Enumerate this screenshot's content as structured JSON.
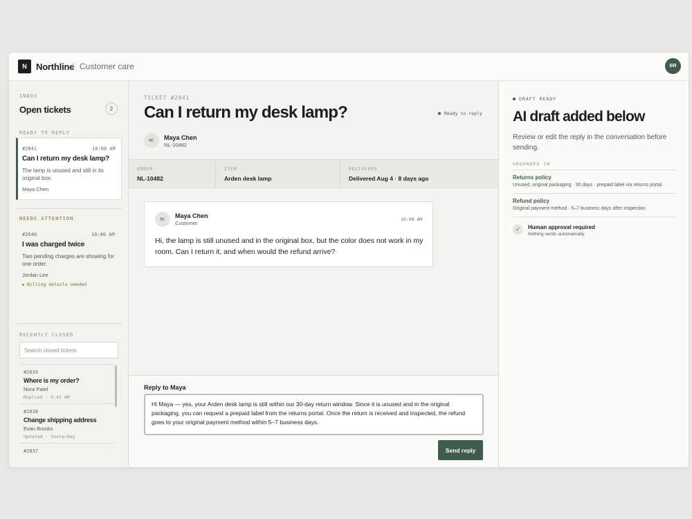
{
  "header": {
    "logo_letter": "N",
    "brand": "Northline",
    "separator": "/",
    "section": "Customer care",
    "user_initials": "BR"
  },
  "sidebar": {
    "inbox_label": "INBOX",
    "title": "Open tickets",
    "count": "2",
    "ready_label": "READY TO REPLY",
    "active_ticket": {
      "id": "#2841",
      "time": "10:08 AM",
      "title": "Can I return my desk lamp?",
      "preview": "The lamp is unused and still in its original box.",
      "customer": "Maya Chen"
    },
    "attention_label": "NEEDS ATTENTION",
    "attention_ticket": {
      "id": "#2840",
      "time": "10:06 AM",
      "title": "I was charged twice",
      "preview": "Two pending charges are showing for one order.",
      "customer": "Jordan Lee",
      "flag": "Billing details needed"
    },
    "closed_label": "RECENTLY CLOSED",
    "search_placeholder": "Search closed tickets",
    "closed": [
      {
        "id": "#2839",
        "title": "Where is my order?",
        "customer": "Nora Patel",
        "meta": "Replied · 9:42 AM"
      },
      {
        "id": "#2838",
        "title": "Change shipping address",
        "customer": "Evan Brooks",
        "meta": "Updated · Yesterday"
      },
      {
        "id": "#2837"
      }
    ]
  },
  "ticket": {
    "label": "TICKET #2841",
    "title": "Can I return my desk lamp?",
    "status": "Ready to reply",
    "customer_initials": "MC",
    "customer_name": "Maya Chen",
    "customer_id": "NL-10482",
    "meta": [
      {
        "key": "ORDER",
        "value": "NL-10482"
      },
      {
        "key": "ITEM",
        "value": "Arden desk lamp"
      },
      {
        "key": "DELIVERED",
        "value": "Delivered Aug 4 · 8 days ago"
      }
    ],
    "message": {
      "initials": "MC",
      "author": "Maya Chen",
      "role": "Customer",
      "time": "10:08 AM",
      "text": "Hi, the lamp is still unused and in the original box, but the color does not work in my room. Can I return it, and when would the refund arrive?"
    }
  },
  "reply": {
    "label": "Reply to Maya",
    "text": "Hi Maya — yes, your Arden desk lamp is still within our 30-day return window. Since it is unused and in the original packaging, you can request a prepaid label from the returns portal. Once the return is received and inspected, the refund goes to your original payment method within 5–7 business days.",
    "send_label": "Send reply"
  },
  "right_panel": {
    "flag": "DRAFT READY",
    "title": "AI draft added below",
    "description": "Review or edit the reply in the conversation before sending.",
    "grounded_label": "GROUNDED IN",
    "policies": [
      {
        "title": "Returns policy",
        "detail": "Unused, original packaging · 30 days · prepaid label via returns portal"
      },
      {
        "title": "Refund policy",
        "detail": "Original payment method · 5–7 business days after inspection"
      }
    ],
    "approval_title": "Human approval required",
    "approval_sub": "Nothing sends automatically."
  },
  "colors": {
    "accent": "#3f5c4c",
    "warning": "#b78a2e"
  }
}
